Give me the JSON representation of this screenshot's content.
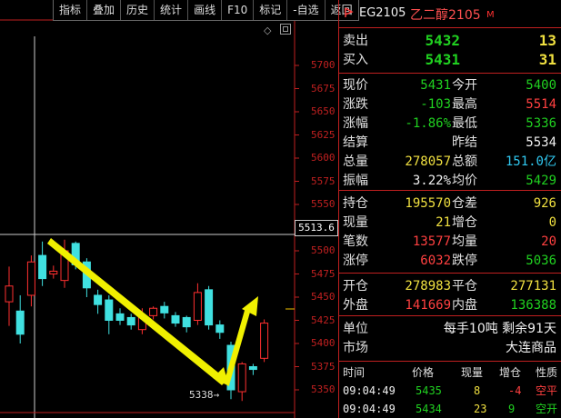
{
  "toolbar": [
    "指标",
    "叠加",
    "历史",
    "统计",
    "画线",
    "F10",
    "标记",
    "-自选",
    "返回"
  ],
  "price_axis": {
    "ticks": [
      "5700",
      "5675",
      "5650",
      "5625",
      "5600",
      "5575",
      "5550",
      "5525",
      "5500",
      "5475",
      "5450",
      "5425",
      "5400",
      "5375",
      "5350"
    ],
    "cursor_price": "5513.6",
    "low_label": "5338"
  },
  "candles": [
    {
      "o": 5445,
      "c": 5462,
      "h": 5483,
      "l": 5419
    },
    {
      "o": 5435,
      "c": 5410,
      "h": 5452,
      "l": 5400
    },
    {
      "o": 5452,
      "c": 5488,
      "h": 5495,
      "l": 5440
    },
    {
      "o": 5495,
      "c": 5470,
      "h": 5510,
      "l": 5462
    },
    {
      "o": 5475,
      "c": 5478,
      "h": 5484,
      "l": 5470
    },
    {
      "o": 5468,
      "c": 5500,
      "h": 5512,
      "l": 5460
    },
    {
      "o": 5508,
      "c": 5485,
      "h": 5510,
      "l": 5480
    },
    {
      "o": 5488,
      "c": 5460,
      "h": 5492,
      "l": 5450
    },
    {
      "o": 5452,
      "c": 5442,
      "h": 5458,
      "l": 5432
    },
    {
      "o": 5447,
      "c": 5425,
      "h": 5452,
      "l": 5410
    },
    {
      "o": 5432,
      "c": 5425,
      "h": 5438,
      "l": 5420
    },
    {
      "o": 5428,
      "c": 5420,
      "h": 5432,
      "l": 5415
    },
    {
      "o": 5415,
      "c": 5430,
      "h": 5438,
      "l": 5410
    },
    {
      "o": 5430,
      "c": 5438,
      "h": 5440,
      "l": 5426
    },
    {
      "o": 5440,
      "c": 5433,
      "h": 5445,
      "l": 5427
    },
    {
      "o": 5430,
      "c": 5422,
      "h": 5434,
      "l": 5418
    },
    {
      "o": 5428,
      "c": 5418,
      "h": 5430,
      "l": 5412
    },
    {
      "o": 5425,
      "c": 5455,
      "h": 5465,
      "l": 5420
    },
    {
      "o": 5458,
      "c": 5420,
      "h": 5462,
      "l": 5415
    },
    {
      "o": 5420,
      "c": 5412,
      "h": 5425,
      "l": 5405
    },
    {
      "o": 5398,
      "c": 5350,
      "h": 5402,
      "l": 5340
    },
    {
      "o": 5348,
      "c": 5378,
      "h": 5380,
      "l": 5338
    },
    {
      "o": 5375,
      "c": 5372,
      "h": 5378,
      "l": 5366
    },
    {
      "o": 5384,
      "c": 5422,
      "h": 5426,
      "l": 5380
    }
  ],
  "panel": {
    "code": "EG2105",
    "name": "乙二醇2105",
    "badge": "M",
    "sell": {
      "label": "卖出",
      "price": "5432",
      "vol": "13"
    },
    "buy": {
      "label": "买入",
      "price": "5431",
      "vol": "31"
    },
    "quote": [
      {
        "l1": "现价",
        "v1": "5431",
        "c1": "green",
        "l2": "今开",
        "v2": "5400",
        "c2": "green"
      },
      {
        "l1": "涨跌",
        "v1": "-103",
        "c1": "green",
        "l2": "最高",
        "v2": "5514",
        "c2": "red"
      },
      {
        "l1": "涨幅",
        "v1": "-1.86%",
        "c1": "green",
        "l2": "最低",
        "v2": "5336",
        "c2": "green"
      },
      {
        "l1": "结算",
        "v1": "",
        "c1": "white",
        "l2": "昨结",
        "v2": "5534",
        "c2": "white"
      },
      {
        "l1": "总量",
        "v1": "278057",
        "c1": "yellow",
        "l2": "总额",
        "v2": "151.0亿",
        "c2": "cyan"
      },
      {
        "l1": "振幅",
        "v1": "3.22%",
        "c1": "white",
        "l2": "均价",
        "v2": "5429",
        "c2": "green"
      }
    ],
    "position": [
      {
        "l1": "持仓",
        "v1": "195570",
        "c1": "yellow",
        "l2": "仓差",
        "v2": "926",
        "c2": "yellow"
      },
      {
        "l1": "现量",
        "v1": "21",
        "c1": "yellow",
        "l2": "增仓",
        "v2": "0",
        "c2": "yellow"
      },
      {
        "l1": "笔数",
        "v1": "13577",
        "c1": "red",
        "l2": "均量",
        "v2": "20",
        "c2": "red"
      },
      {
        "l1": "涨停",
        "v1": "6032",
        "c1": "red",
        "l2": "跌停",
        "v2": "5036",
        "c2": "green"
      }
    ],
    "open_close": [
      {
        "l1": "开仓",
        "v1": "278983",
        "c1": "yellow",
        "l2": "平仓",
        "v2": "277131",
        "c2": "yellow"
      },
      {
        "l1": "外盘",
        "v1": "141669",
        "c1": "red",
        "l2": "内盘",
        "v2": "136388",
        "c2": "green"
      }
    ],
    "info": [
      {
        "l1": "单位",
        "v2": "每手10吨  剩余91天"
      },
      {
        "l1": "市场",
        "v2": "大连商品"
      }
    ],
    "trades_head": [
      "时间",
      "价格",
      "现量",
      "增仓",
      "性质"
    ],
    "trades": [
      {
        "time": "09:04:49",
        "price": "5435",
        "vol": "8",
        "oi": "-4",
        "nature": "空平",
        "pc": "green",
        "oc": "red",
        "nc": "red"
      },
      {
        "time": "09:04:49",
        "price": "5434",
        "vol": "23",
        "oi": "9",
        "nature": "空开",
        "pc": "green",
        "oc": "green",
        "nc": "green"
      }
    ]
  }
}
